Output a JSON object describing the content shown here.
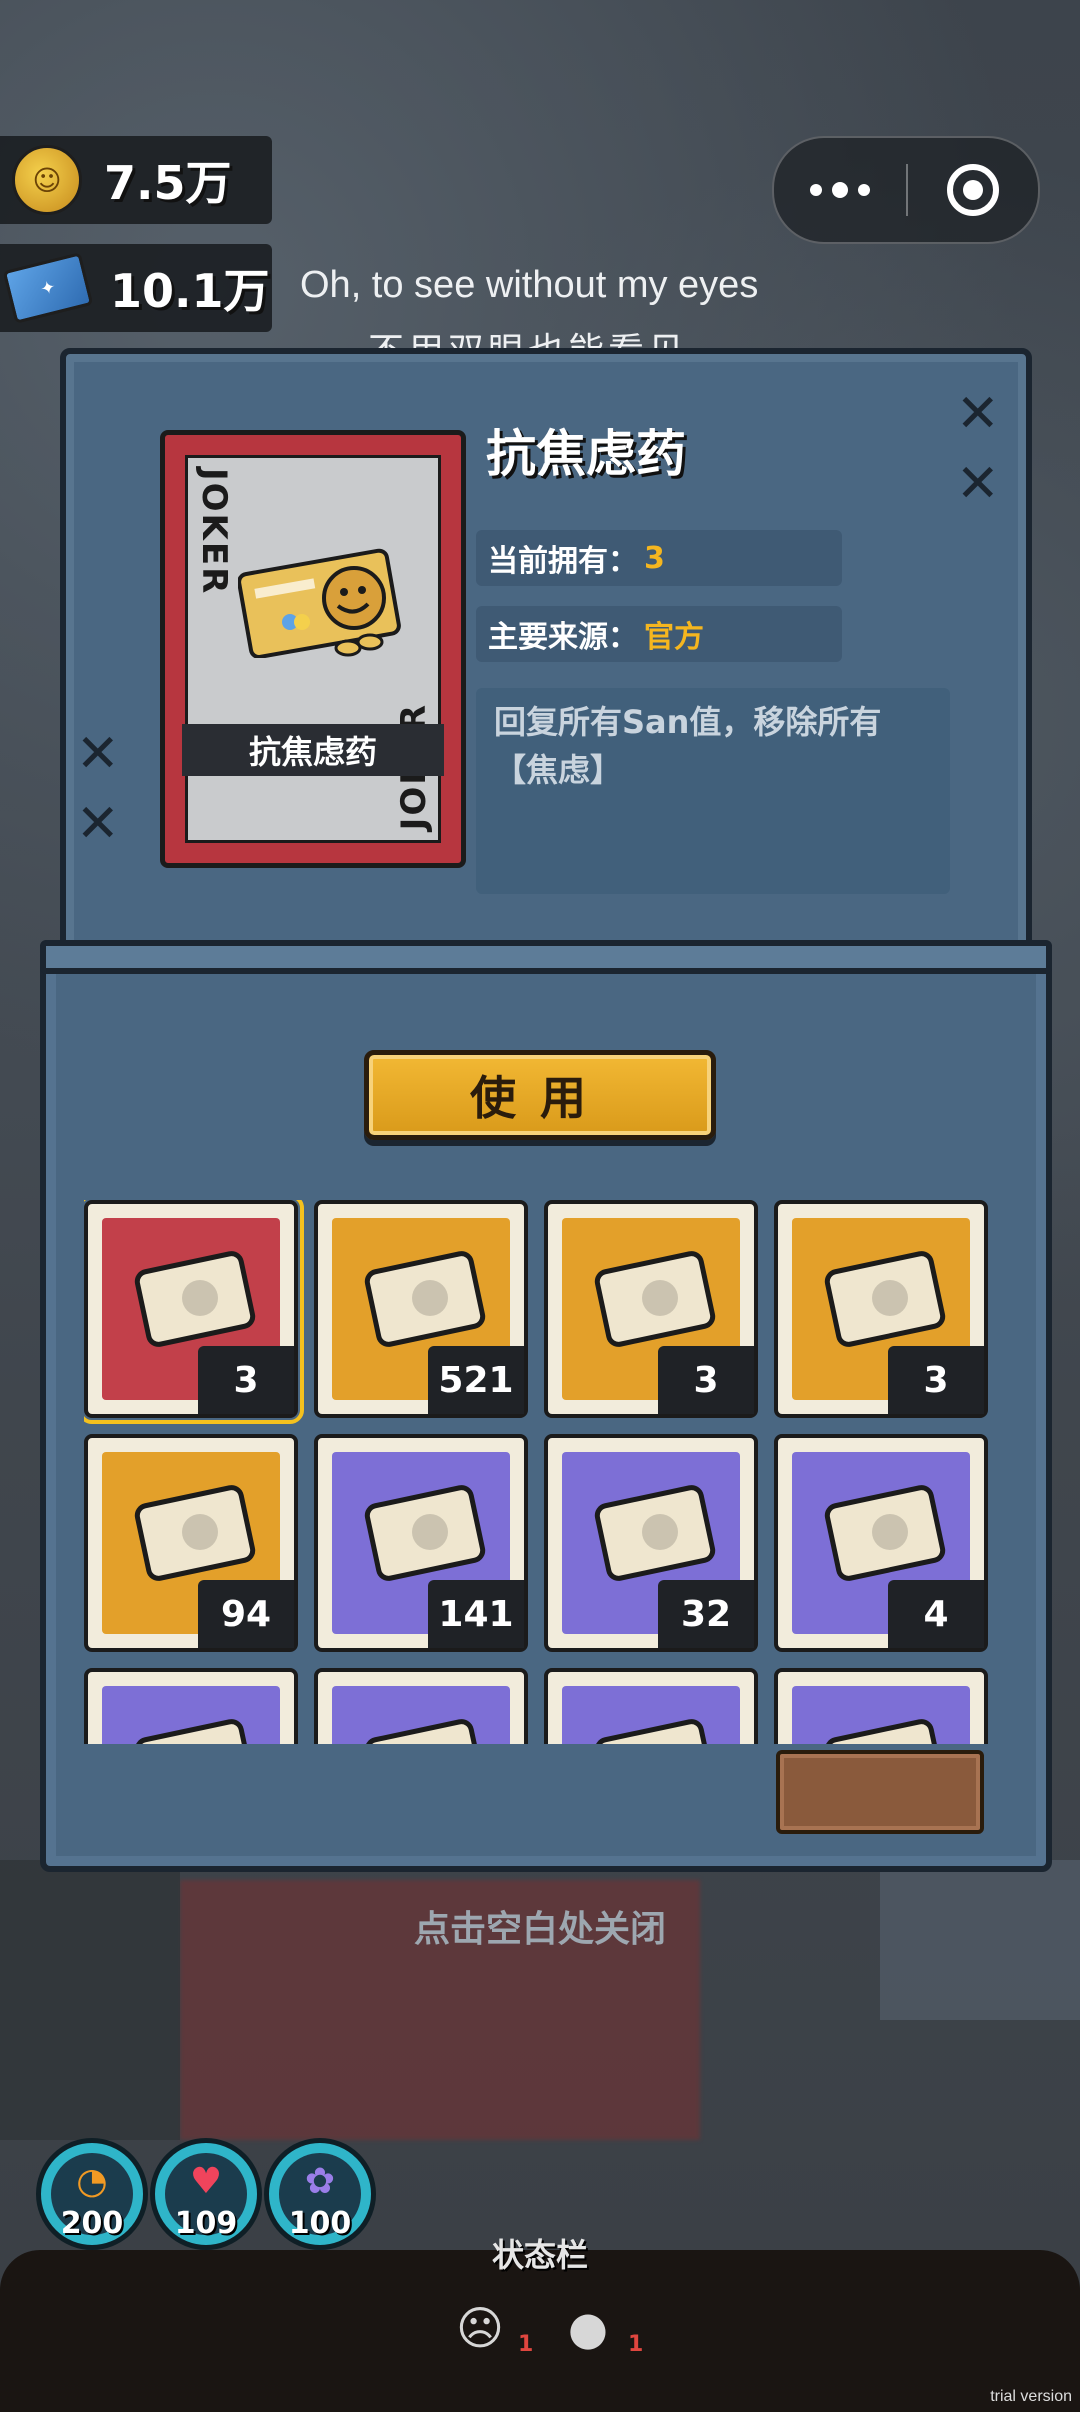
{
  "currency": [
    {
      "icon": "gold-coin-icon",
      "value": "7.5万"
    },
    {
      "icon": "ticket-icon",
      "value": "10.1万"
    }
  ],
  "quote": {
    "en": "Oh, to see without my eyes",
    "cn": "不用双眼也能看见"
  },
  "card": {
    "corner_text": "JOKER",
    "label": "抗焦虑药",
    "color": "#b7363f"
  },
  "item": {
    "title": "抗焦虑药",
    "owned_label": "当前拥有：",
    "owned_value": "3",
    "source_label": "主要来源：",
    "source_value": "官方",
    "description": "回复所有San值，移除所有【焦虑】"
  },
  "use_button": "使用",
  "inventory": [
    {
      "name": "anti-anxiety-pills",
      "count": "3",
      "bg": "#c2404a",
      "selected": true
    },
    {
      "name": "film-reel",
      "count": "521",
      "bg": "#e3a02a"
    },
    {
      "name": "gold-badge",
      "count": "3",
      "bg": "#e3a02a"
    },
    {
      "name": "medical-card",
      "count": "3",
      "bg": "#e3a02a"
    },
    {
      "name": "gold-ribbon-card",
      "count": "94",
      "bg": "#e3a02a"
    },
    {
      "name": "toy-ticket",
      "count": "141",
      "bg": "#7d6fd6"
    },
    {
      "name": "blue-pass",
      "count": "32",
      "bg": "#7d6fd6"
    },
    {
      "name": "sunglasses-card",
      "count": "4",
      "bg": "#7d6fd6"
    },
    {
      "name": "bottle",
      "count": "",
      "bg": "#7d6fd6"
    },
    {
      "name": "item-10",
      "count": "",
      "bg": "#7d6fd6"
    },
    {
      "name": "item-11",
      "count": "",
      "bg": "#7d6fd6"
    },
    {
      "name": "item-12",
      "count": "",
      "bg": "#7d6fd6"
    }
  ],
  "close_tip": "点击空白处关闭",
  "stats": [
    {
      "icon": "hunger-icon",
      "value": "200"
    },
    {
      "icon": "heart-icon",
      "value": "109"
    },
    {
      "icon": "brain-icon",
      "value": "100"
    }
  ],
  "status_bar": {
    "title": "状态栏",
    "effects": [
      {
        "icon": "mask-icon",
        "count": "1"
      },
      {
        "icon": "sleep-icon",
        "count": "1"
      }
    ]
  },
  "watermark": "trial version"
}
